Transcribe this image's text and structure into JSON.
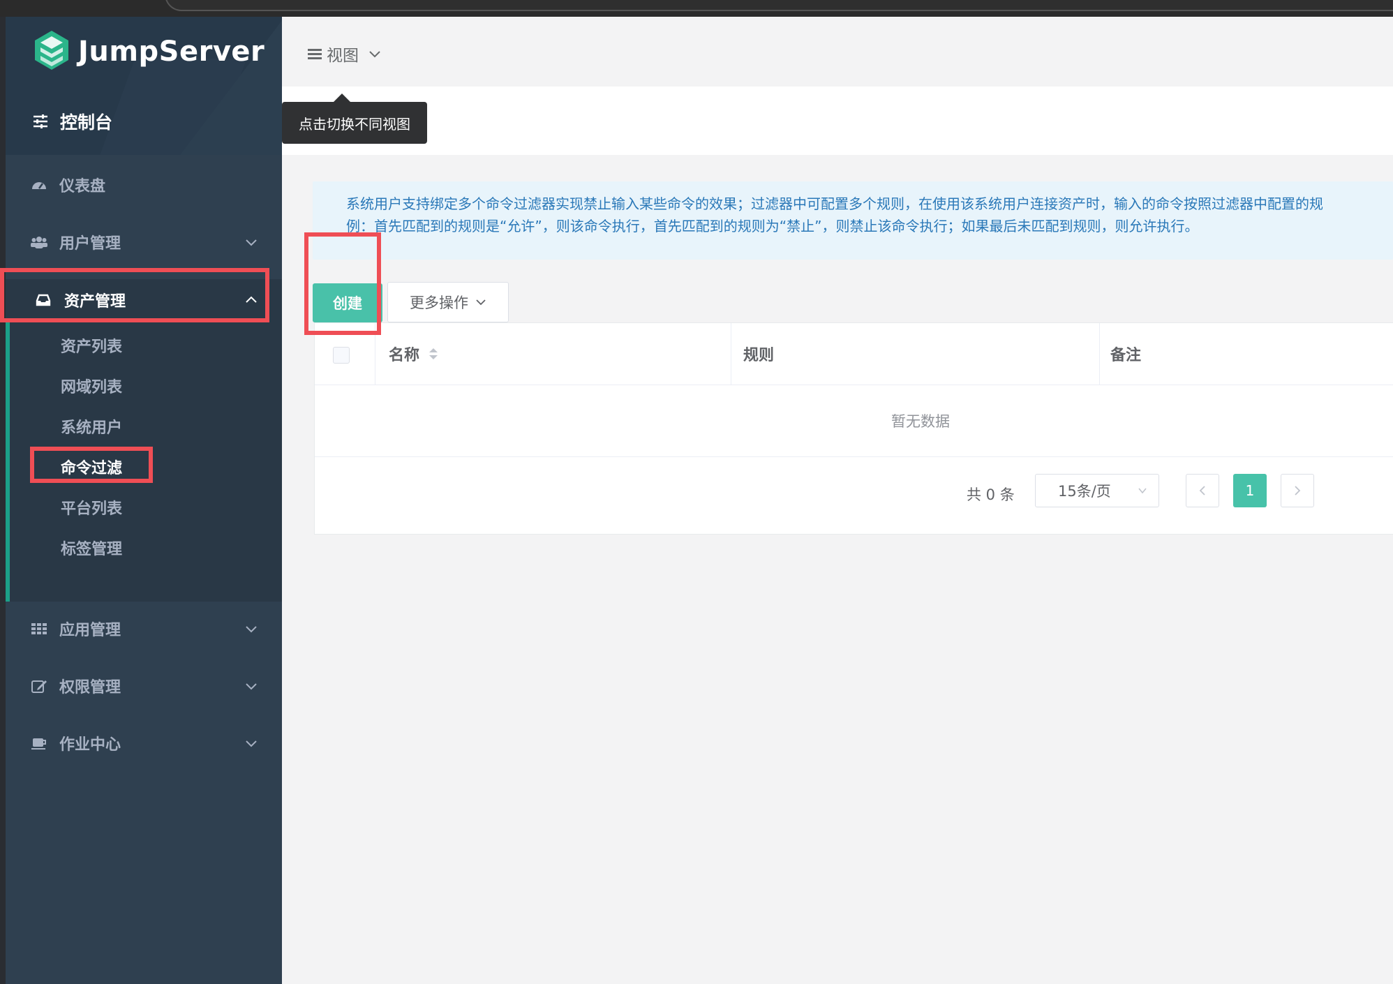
{
  "app": {
    "brand": "JumpServer",
    "console_label": "控制台",
    "accent": "#1ab394",
    "annotation_color": "#ef4e55"
  },
  "sidebar": {
    "items": [
      {
        "label": "仪表盘",
        "icon": "dashboard-icon"
      },
      {
        "label": "用户管理",
        "icon": "users-icon"
      },
      {
        "label": "资产管理",
        "icon": "inbox-icon",
        "expanded": true
      },
      {
        "label": "应用管理",
        "icon": "grid-icon"
      },
      {
        "label": "权限管理",
        "icon": "edit-icon"
      },
      {
        "label": "作业中心",
        "icon": "coffee-icon"
      }
    ],
    "asset_submenu": [
      {
        "label": "资产列表"
      },
      {
        "label": "网域列表"
      },
      {
        "label": "系统用户"
      },
      {
        "label": "命令过滤",
        "active": true
      },
      {
        "label": "平台列表"
      },
      {
        "label": "标签管理"
      }
    ]
  },
  "header": {
    "view_label": "视图",
    "tooltip": "点击切换不同视图"
  },
  "alert": {
    "line1": "系统用户支持绑定多个命令过滤器实现禁止输入某些命令的效果；过滤器中可配置多个规则，在使用该系统用户连接资产时，输入的命令按照过滤器中配置的规",
    "line2": "例：首先匹配到的规则是“允许”，则该命令执行，首先匹配到的规则为“禁止”，则禁止该命令执行；如果最后未匹配到规则，则允许执行。"
  },
  "toolbar": {
    "create_label": "创建",
    "more_label": "更多操作"
  },
  "table": {
    "columns": [
      "名称",
      "规则",
      "备注"
    ],
    "empty_text": "暂无数据"
  },
  "pagination": {
    "total_text": "共 0 条",
    "page_size": "15条/页",
    "current_page": "1"
  }
}
